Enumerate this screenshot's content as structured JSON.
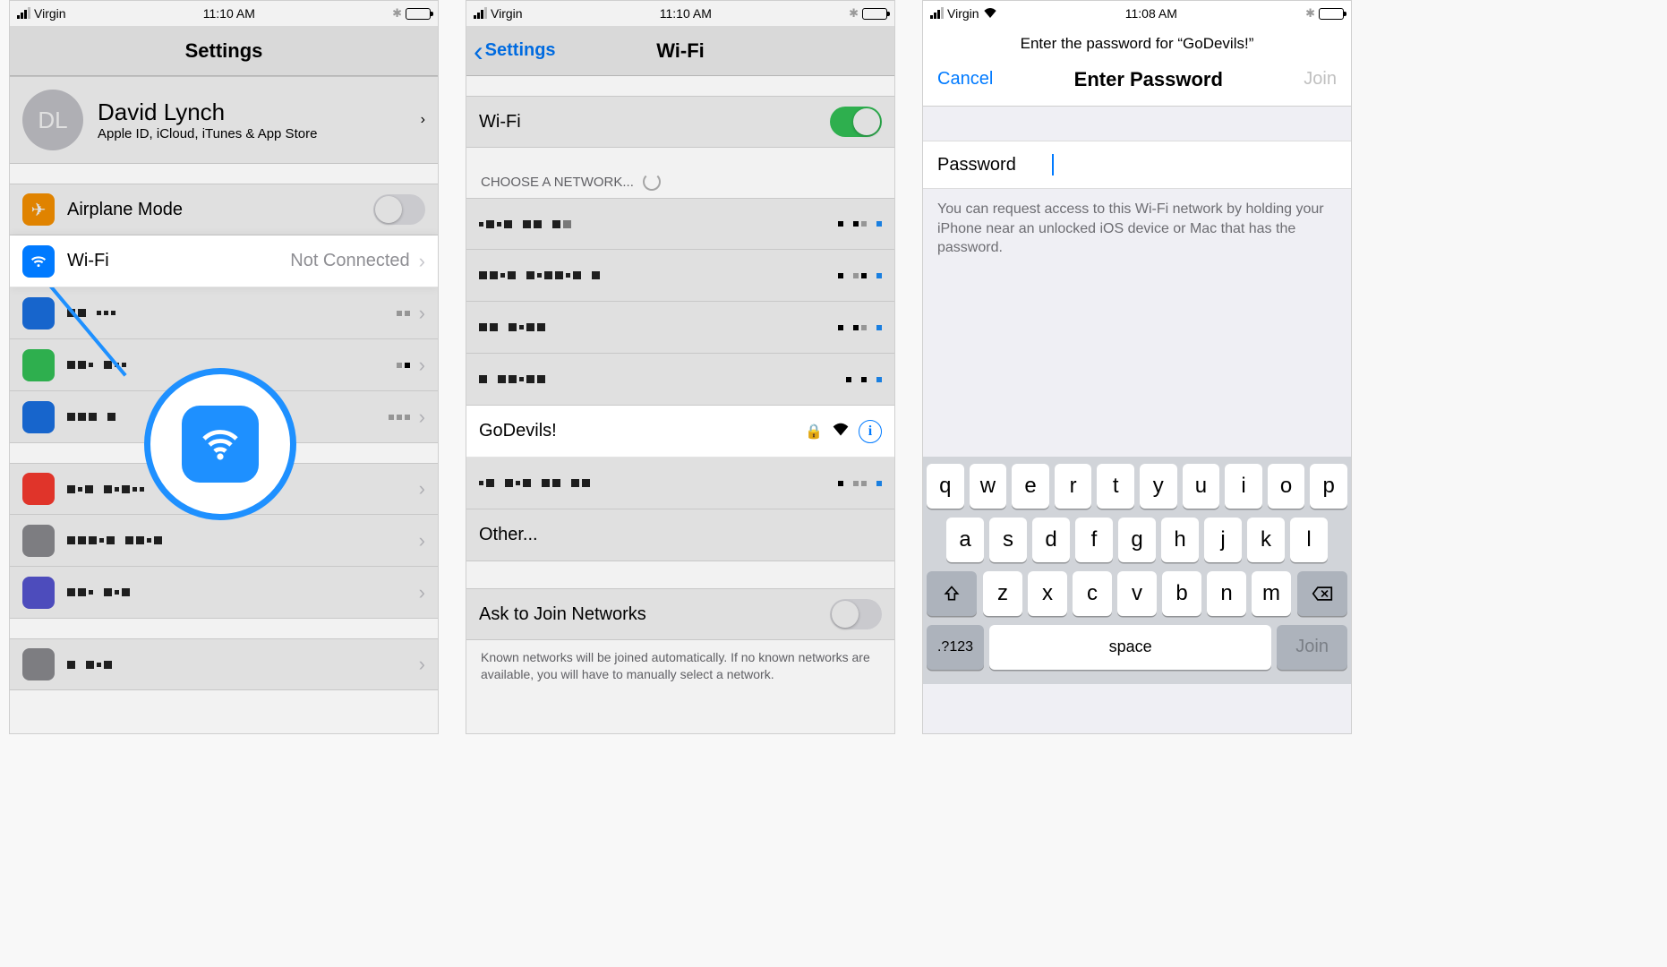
{
  "phone1": {
    "status": {
      "carrier": "Virgin",
      "time": "11:10 AM"
    },
    "title": "Settings",
    "account": {
      "initials": "DL",
      "name": "David Lynch",
      "subtitle": "Apple ID, iCloud, iTunes & App Store"
    },
    "airplane": {
      "label": "Airplane Mode"
    },
    "wifi": {
      "label": "Wi-Fi",
      "status": "Not Connected"
    }
  },
  "phone2": {
    "status": {
      "carrier": "Virgin",
      "time": "11:10 AM"
    },
    "back": "Settings",
    "title": "Wi-Fi",
    "wifi_label": "Wi-Fi",
    "choose": "CHOOSE A NETWORK...",
    "highlighted_network": "GoDevils!",
    "other": "Other...",
    "ask": "Ask to Join Networks",
    "footer": "Known networks will be joined automatically. If no known networks are available, you will have to manually select a network."
  },
  "phone3": {
    "status": {
      "carrier": "Virgin",
      "time": "11:08 AM"
    },
    "subheader": "Enter the password for “GoDevils!”",
    "cancel": "Cancel",
    "title": "Enter Password",
    "join": "Join",
    "password_label": "Password",
    "hint": "You can request access to this Wi-Fi network by holding your iPhone near an unlocked iOS device or Mac that has the password.",
    "keys_row1": [
      "q",
      "w",
      "e",
      "r",
      "t",
      "y",
      "u",
      "i",
      "o",
      "p"
    ],
    "keys_row2": [
      "a",
      "s",
      "d",
      "f",
      "g",
      "h",
      "j",
      "k",
      "l"
    ],
    "keys_row3": [
      "z",
      "x",
      "c",
      "v",
      "b",
      "n",
      "m"
    ],
    "key_numbers": ".?123",
    "key_space": "space",
    "key_join": "Join"
  }
}
